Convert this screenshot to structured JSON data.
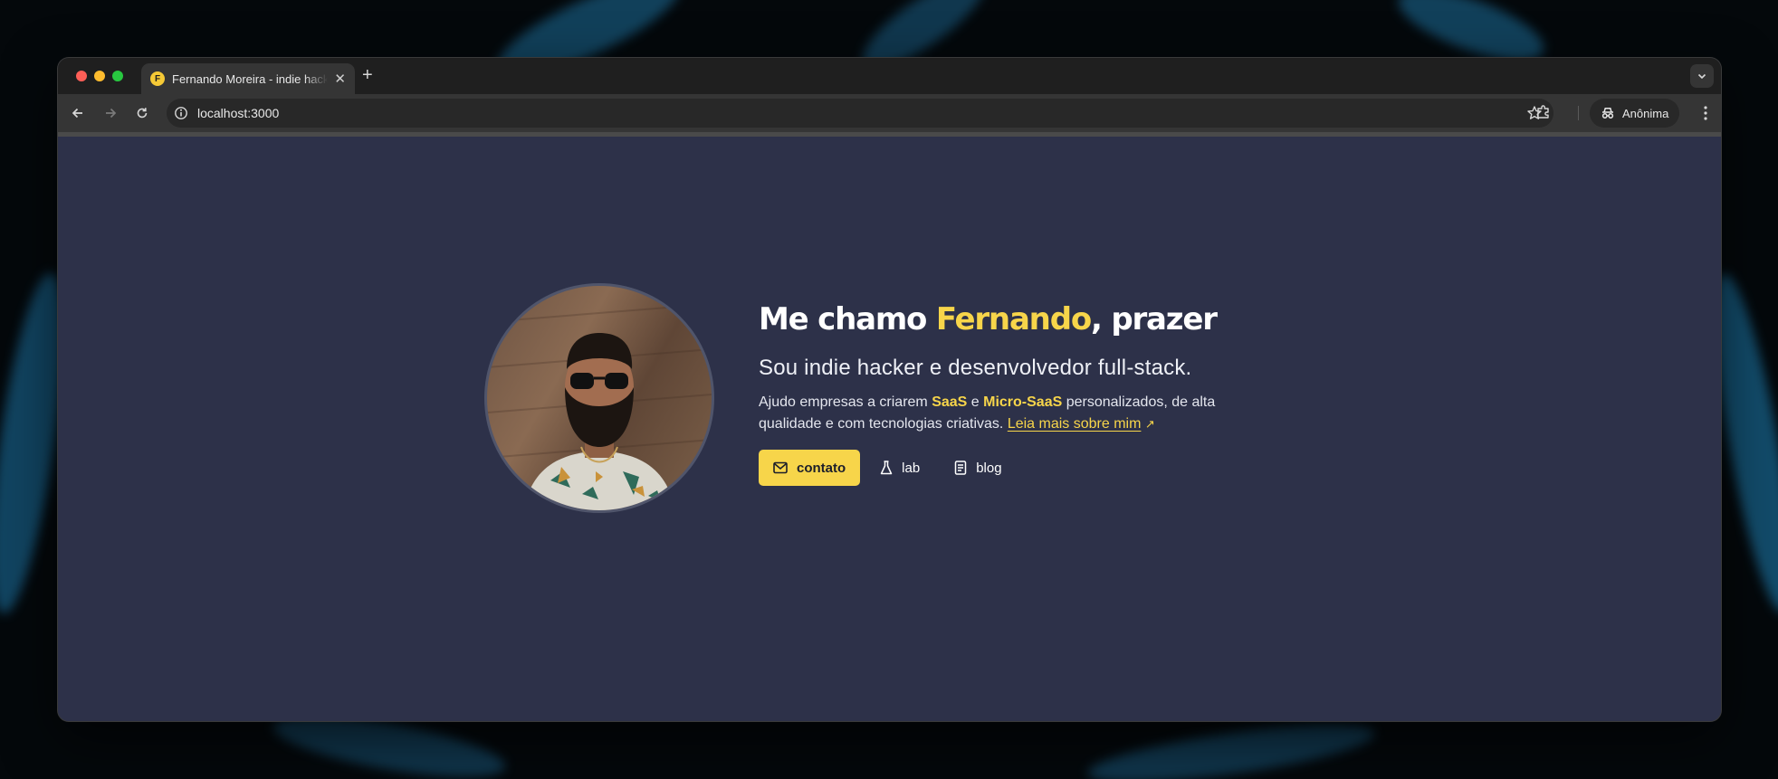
{
  "browser": {
    "tab_title": "Fernando Moreira - indie hacker",
    "tab_favicon_letter": "F",
    "url": "localhost:3000",
    "profile_label": "Anônima",
    "colors": {
      "accent": "#f7d54a",
      "page_bg": "#2d3149",
      "chrome": "#1f1f1f"
    }
  },
  "hero": {
    "heading_prefix": "Me chamo ",
    "heading_name": "Fernando",
    "heading_suffix": ", prazer",
    "subtitle": "Sou indie hacker e desenvolvedor full-stack.",
    "desc_part1": "Ajudo empresas a criarem ",
    "desc_saas": "SaaS",
    "desc_part2": " e ",
    "desc_microsaas": "Micro-SaaS",
    "desc_part3": " personalizados, de alta qualidade e com tecnologias criativas. ",
    "read_more": "Leia mais sobre mim",
    "read_more_arrow": "↗"
  },
  "actions": {
    "contact_label": "contato",
    "lab_label": "lab",
    "blog_label": "blog"
  },
  "icons": [
    "close-icon",
    "plus-icon",
    "chevron-down-icon",
    "back-icon",
    "forward-icon",
    "reload-icon",
    "info-icon",
    "star-icon",
    "extension-icon",
    "incognito-icon",
    "kebab-icon",
    "mail-icon",
    "flask-icon",
    "document-icon"
  ]
}
